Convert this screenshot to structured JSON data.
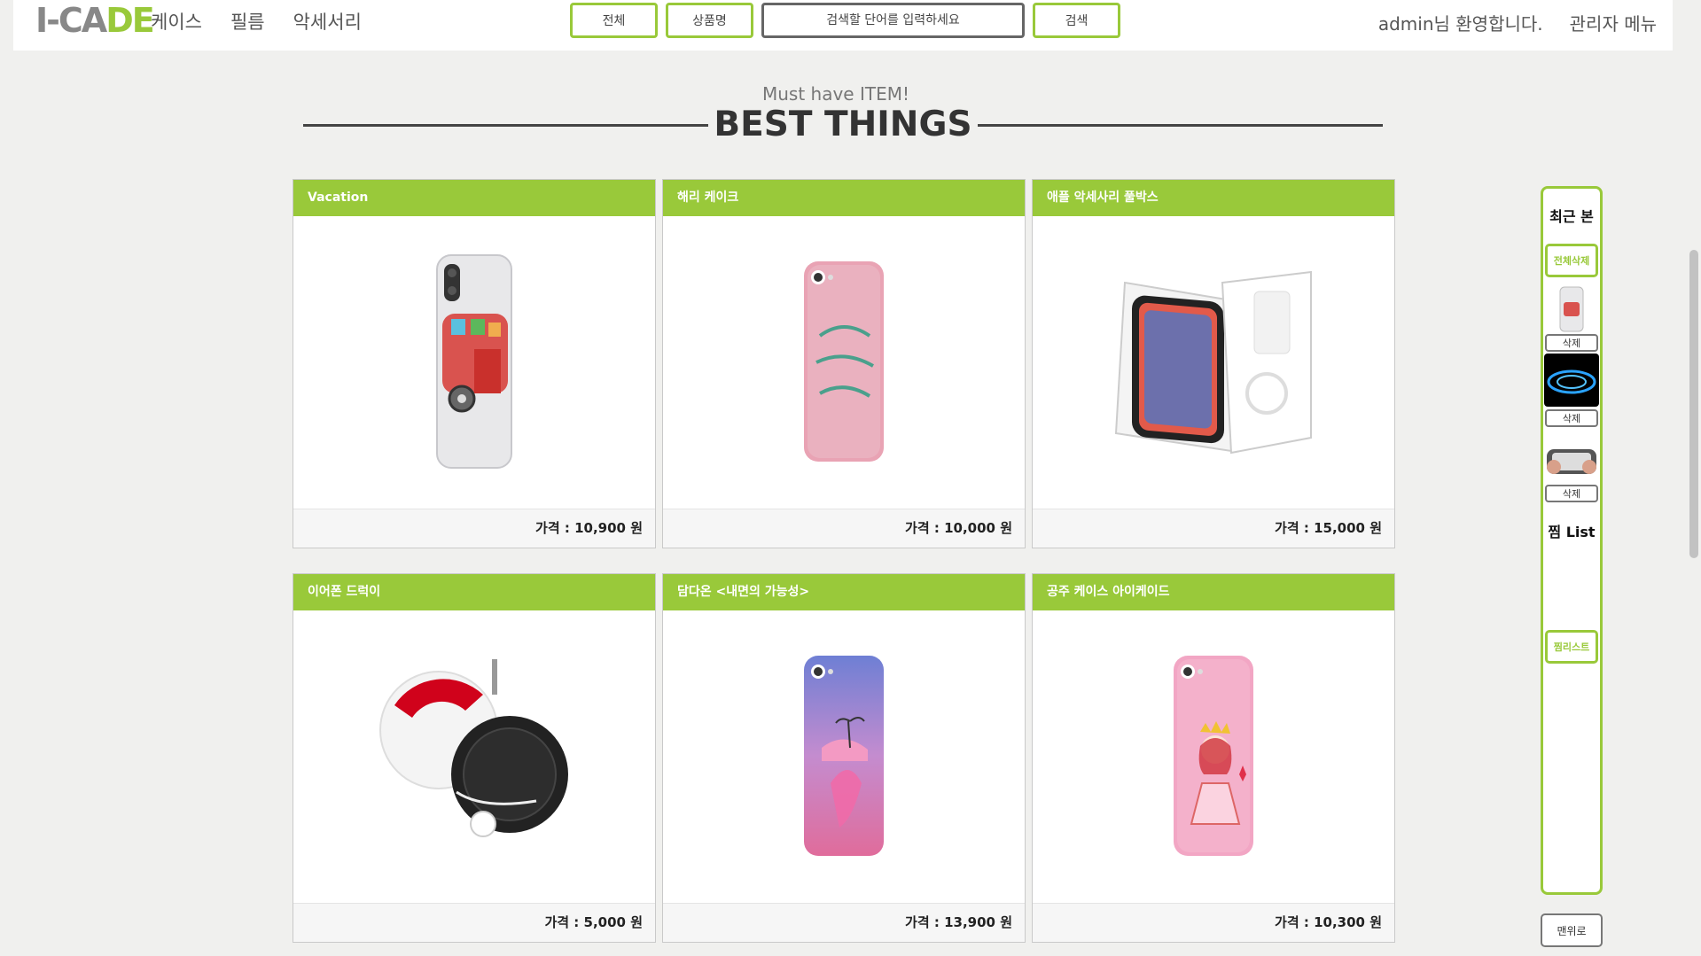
{
  "header": {
    "logo_a": "I-",
    "logo_b": "CA",
    "logo_c": "DE",
    "nav": [
      "케이스",
      "필름",
      "악세서리"
    ],
    "search": {
      "btn_all": "전체",
      "btn_name": "상품명",
      "placeholder": "검색할 단어를 입력하세요",
      "btn_search": "검색"
    },
    "welcome": "admin님 환영합니다.",
    "admin_menu": "관리자 메뉴"
  },
  "section": {
    "subtitle": "Must have ITEM!",
    "title": "BEST THINGS"
  },
  "products": [
    {
      "name": "Vacation",
      "price": "가격 : 10,900 원",
      "icon": "phone-case-vacation-image"
    },
    {
      "name": "해리 케이크",
      "price": "가격 : 10,000 원",
      "icon": "phone-case-harry-image"
    },
    {
      "name": "애플 악세사리 풀박스",
      "price": "가격 : 15,000 원",
      "icon": "iphone-full-box-image"
    },
    {
      "name": "이어폰 드럭이",
      "price": "가격 : 5,000 원",
      "icon": "earphone-winder-image"
    },
    {
      "name": "담다온 <내면의 가능성>",
      "price": "가격 : 13,900 원",
      "icon": "phone-case-island-image"
    },
    {
      "name": "공주 케이스 아이케이드",
      "price": "가격 : 10,300 원",
      "icon": "phone-case-princess-image"
    }
  ],
  "sidebar": {
    "recent_title": "최근 본",
    "delete_all": "전체삭제",
    "delete": "삭제",
    "wish_title": "찜 List",
    "wishlist_btn": "찜리스트",
    "top_btn": "맨위로"
  },
  "colors": {
    "accent": "#99c93a",
    "background": "#f0f0ee"
  }
}
